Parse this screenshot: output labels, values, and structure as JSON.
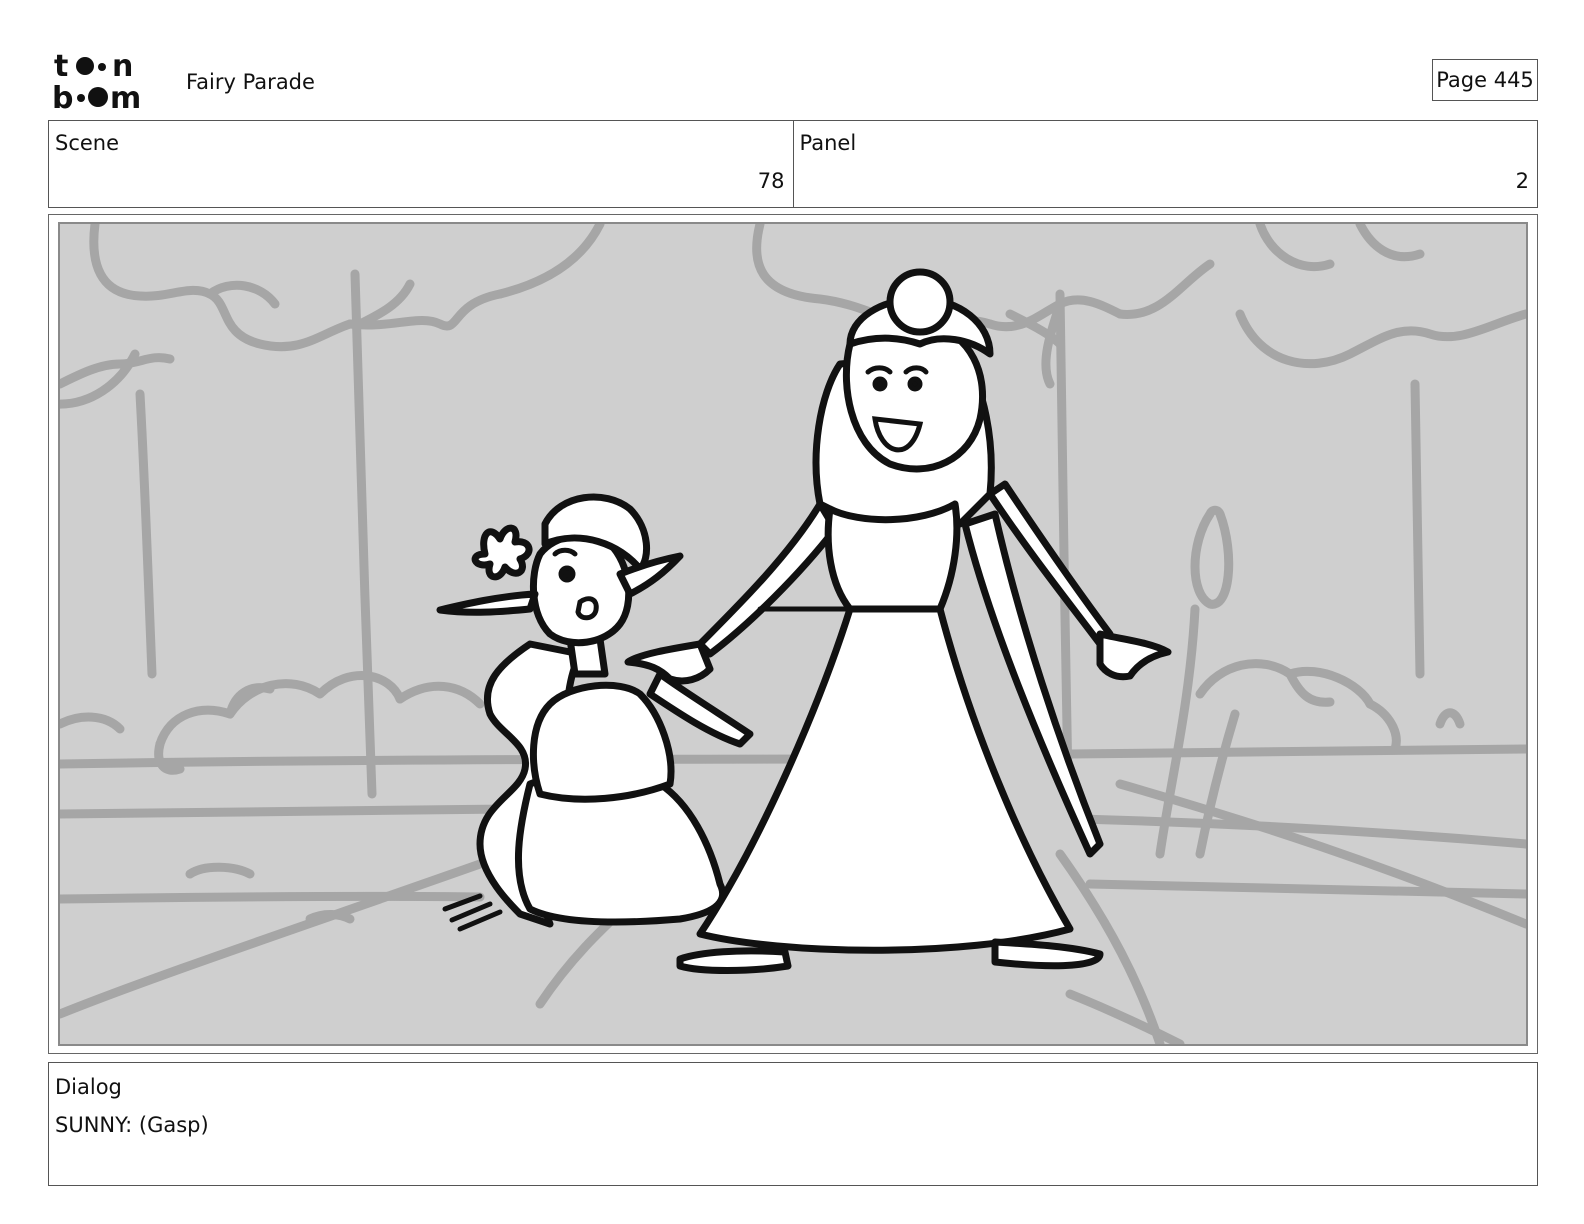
{
  "header": {
    "logo_text": "toon boom",
    "project_title": "Fairy Parade",
    "page_label": "Page 445"
  },
  "info": {
    "scene_label": "Scene",
    "scene_value": "78",
    "panel_label": "Panel",
    "panel_value": "2"
  },
  "panel_image": {
    "description": "Storyboard sketch: a seated gasping girl with a flower in her hair and a smiling princess in a long dress gesturing with open arms, in front of a grey park background with trees and bushes"
  },
  "dialog": {
    "label": "Dialog",
    "text": "SUNNY: (Gasp)"
  }
}
